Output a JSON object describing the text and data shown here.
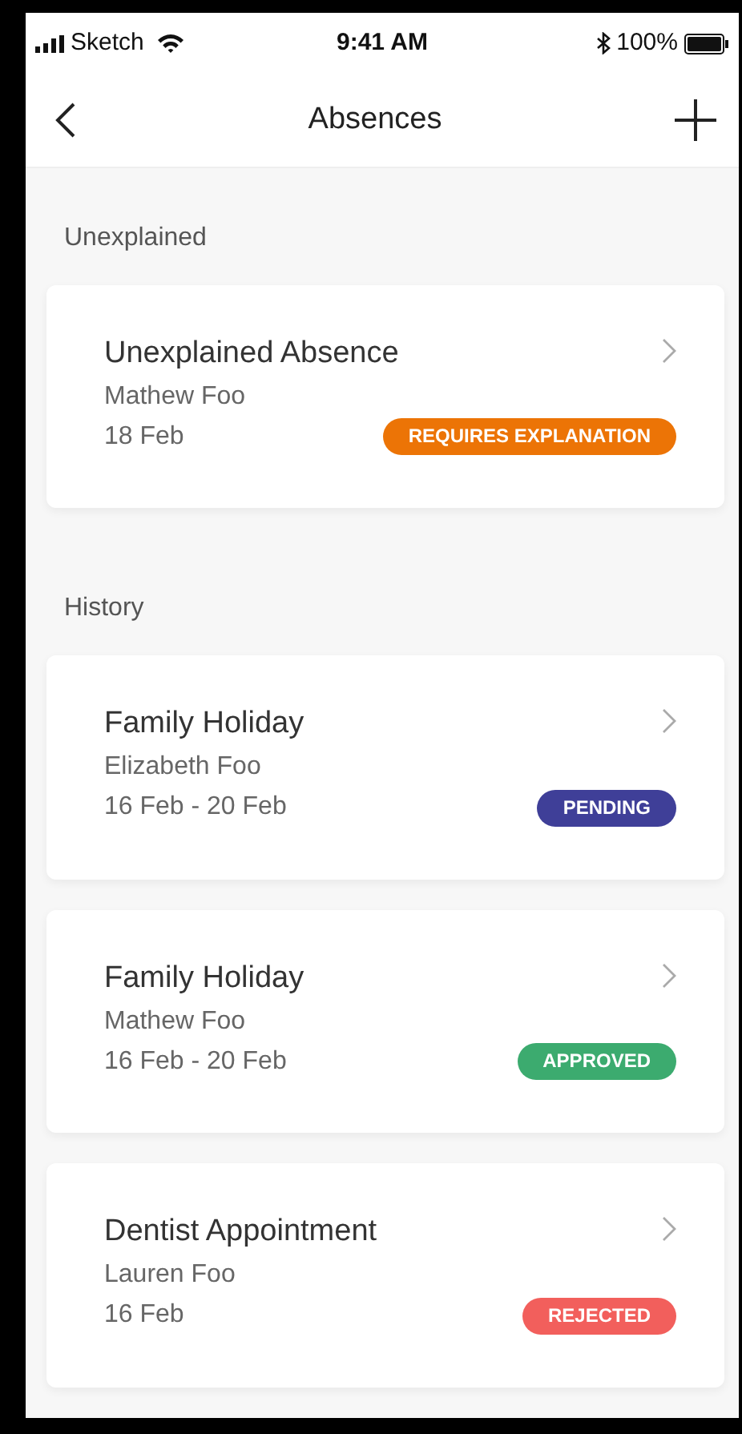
{
  "status_bar": {
    "carrier": "Sketch",
    "time": "9:41 AM",
    "battery": "100%"
  },
  "nav": {
    "title": "Absences"
  },
  "sections": [
    {
      "title": "Unexplained",
      "items": [
        {
          "title": "Unexplained Absence",
          "person": "Mathew Foo",
          "dates": "18 Feb",
          "status": "REQUIRES EXPLANATION",
          "color": "#ec7406"
        }
      ]
    },
    {
      "title": "History",
      "items": [
        {
          "title": "Family Holiday",
          "person": "Elizabeth Foo",
          "dates": "16 Feb - 20 Feb",
          "status": "PENDING",
          "color": "#3f3f98"
        },
        {
          "title": "Family Holiday",
          "person": "Mathew Foo",
          "dates": "16 Feb - 20 Feb",
          "status": "APPROVED",
          "color": "#3cab6f"
        },
        {
          "title": "Dentist Appointment",
          "person": "Lauren Foo",
          "dates": "16 Feb",
          "status": "REJECTED",
          "color": "#f25f5c"
        }
      ]
    }
  ]
}
